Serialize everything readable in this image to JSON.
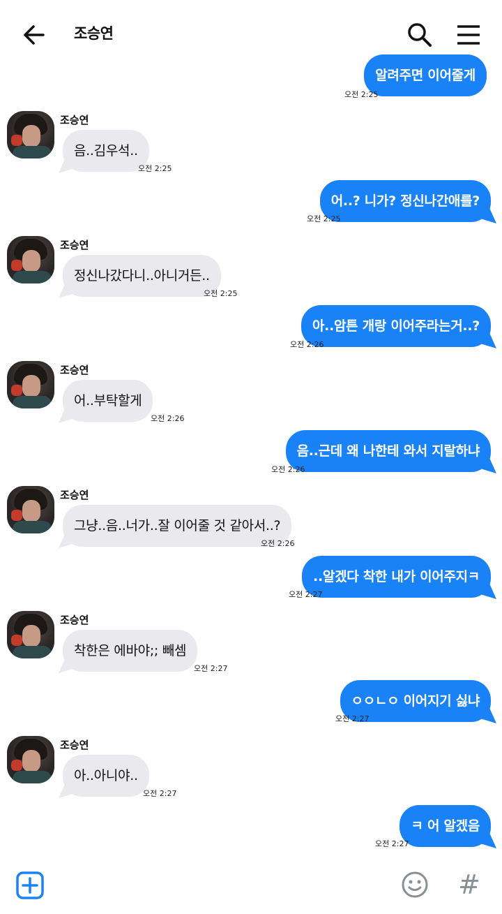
{
  "header": {
    "title": "조승연",
    "back_icon": "arrow-left-icon",
    "search_icon": "search-icon",
    "menu_icon": "hamburger-menu-icon"
  },
  "colors": {
    "outgoing_bubble": "#1a82f7",
    "incoming_bubble": "#e9e9ee"
  },
  "messages": [
    {
      "dir": "out",
      "text": "알려주면 이어줄게",
      "time": "오전 2:25"
    },
    {
      "dir": "in",
      "sender": "조승연",
      "text": "음..김우석..",
      "time": "오전 2:25"
    },
    {
      "dir": "out",
      "text": "어..? 니가? 정신나간애를?",
      "time": "오전 2:25"
    },
    {
      "dir": "in",
      "sender": "조승연",
      "text": "정신나갔다니..아니거든..",
      "time": "오전 2:25"
    },
    {
      "dir": "out",
      "text": "아..암튼 개랑 이어주라는거..?",
      "time": "오전 2:26"
    },
    {
      "dir": "in",
      "sender": "조승연",
      "text": "어..부탁할게",
      "time": "오전 2:26"
    },
    {
      "dir": "out",
      "text": "음..근데 왜 나한테 와서 지랄하냐",
      "time": "오전 2:26"
    },
    {
      "dir": "in",
      "sender": "조승연",
      "text": "그냥..음..너가..잘 이어줄 것 같아서..?",
      "time": "오전 2:26"
    },
    {
      "dir": "out",
      "text": "..알겠다 착한 내가 이어주지ㅋ",
      "time": "오전 2:27"
    },
    {
      "dir": "in",
      "sender": "조승연",
      "text": "착한은 에바야;; 빼셈",
      "time": "오전 2:27"
    },
    {
      "dir": "out",
      "text": "ㅇㅇㄴㅇ 이어지기 싫냐",
      "time": "오전 2:27"
    },
    {
      "dir": "in",
      "sender": "조승연",
      "text": "아..아니야..",
      "time": "오전 2:27"
    },
    {
      "dir": "out",
      "text": "ㅋ 어 알겠음",
      "time": "오전 2:27"
    }
  ],
  "bottom_bar": {
    "add_icon": "plus-square-icon",
    "emoji_icon": "smiley-icon",
    "hashtag_icon": "hashtag-icon",
    "hash_glyph": "#"
  }
}
